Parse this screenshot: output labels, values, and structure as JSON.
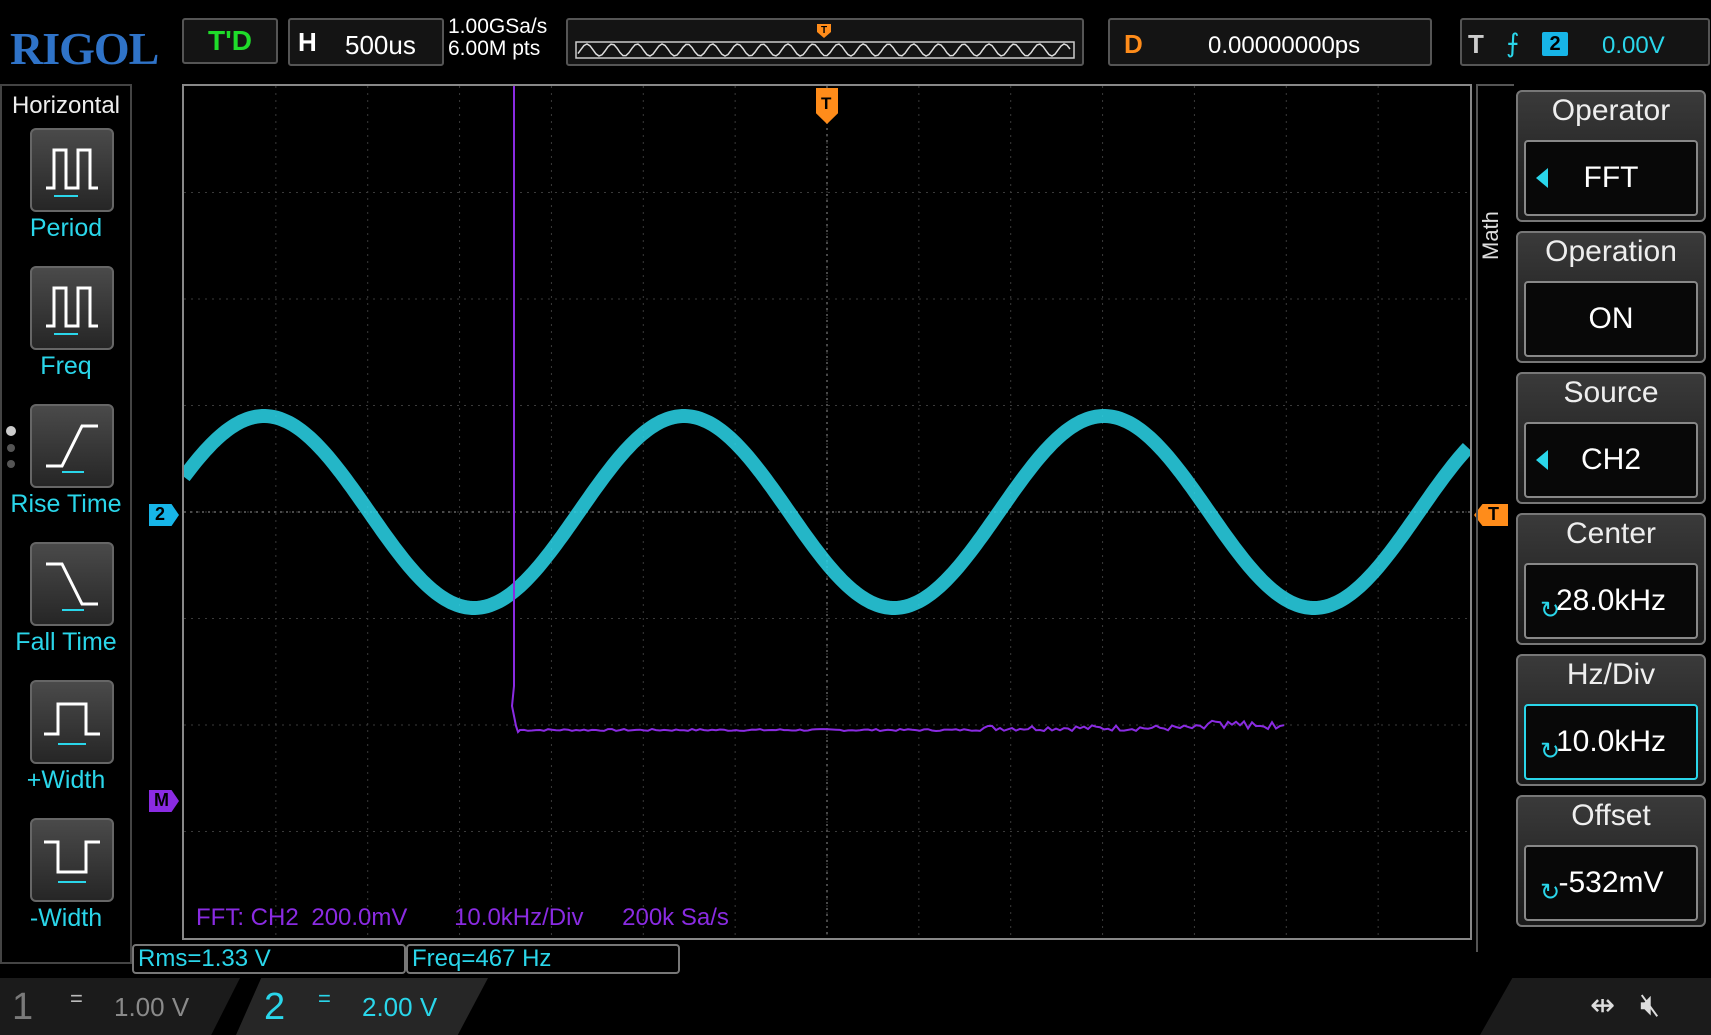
{
  "brand": "RIGOL",
  "status": {
    "run_state": "T'D"
  },
  "horizontal": {
    "key": "H",
    "timebase": "500us"
  },
  "acquisition": {
    "sample_rate": "1.00GSa/s",
    "memory_depth": "6.00M pts"
  },
  "delay": {
    "key": "D",
    "value": "0.00000000ps"
  },
  "trigger": {
    "key": "T",
    "edge_icon": "rising-edge-icon",
    "source_badge": "2",
    "level": "0.00V"
  },
  "left_menu": {
    "title": "Horizontal",
    "items": [
      {
        "label": "Period",
        "icon": "period-icon"
      },
      {
        "label": "Freq",
        "icon": "frequency-icon"
      },
      {
        "label": "Rise Time",
        "icon": "rise-time-icon"
      },
      {
        "label": "Fall Time",
        "icon": "fall-time-icon"
      },
      {
        "label": "+Width",
        "icon": "positive-width-icon"
      },
      {
        "label": "-Width",
        "icon": "negative-width-icon"
      }
    ]
  },
  "right_menu": {
    "tab": "Math",
    "items": [
      {
        "label": "Operator",
        "value": "FFT"
      },
      {
        "label": "Operation",
        "value": "ON"
      },
      {
        "label": "Source",
        "value": "CH2"
      },
      {
        "label": "Center",
        "value": "28.0kHz"
      },
      {
        "label": "Hz/Div",
        "value": "10.0kHz"
      },
      {
        "label": "Offset",
        "value": "-532mV"
      }
    ]
  },
  "markers": {
    "ch2": "2",
    "math": "M",
    "trigger_level": "T",
    "trigger_pos": "T"
  },
  "fft_info": {
    "source": "FFT:  CH2",
    "scale": "200.0mV",
    "hz_div": "10.0kHz/Div",
    "rate": "200k Sa/s"
  },
  "measurements": [
    {
      "text": "Rms=1.33 V"
    },
    {
      "text": "Freq=467 Hz"
    }
  ],
  "channels": [
    {
      "number": "1",
      "coupling": "=",
      "scale": "1.00 V",
      "color": "#7a7a7a"
    },
    {
      "number": "2",
      "coupling": "=",
      "scale": "2.00 V",
      "color": "#2ad6ea"
    }
  ],
  "colors": {
    "ch2": "#2ad6ea",
    "math": "#8a2be2",
    "trigger": "#ff8c1a",
    "run": "#1fdc2a",
    "logo": "#2f73c8"
  },
  "status_icons": [
    "usb-icon",
    "speaker-muted-icon"
  ]
}
